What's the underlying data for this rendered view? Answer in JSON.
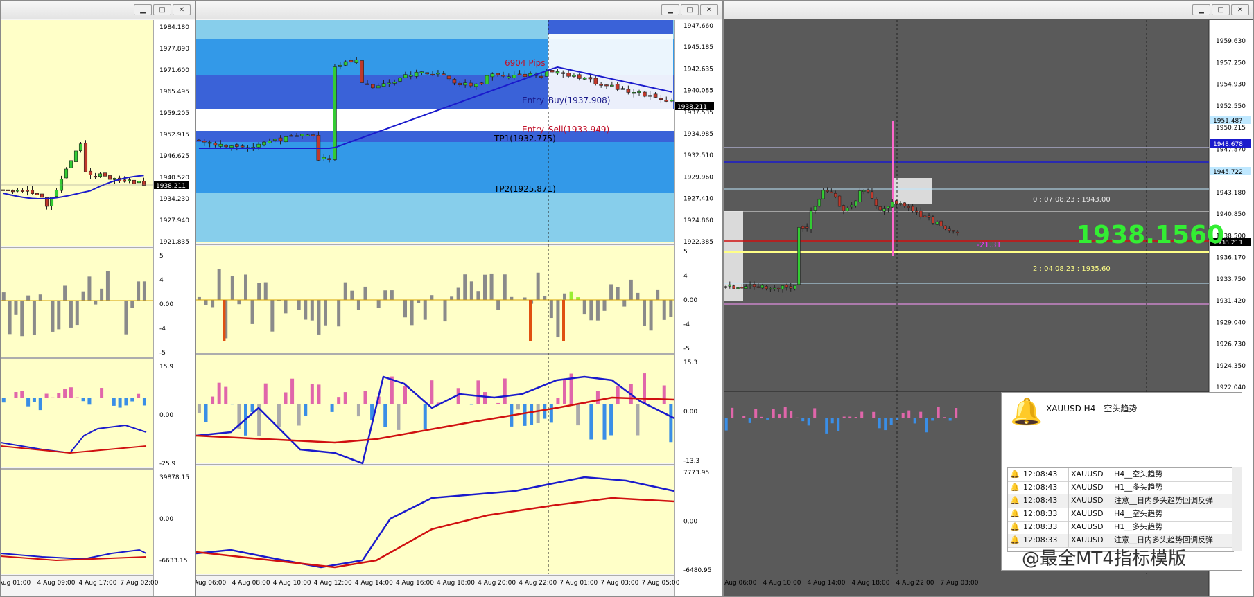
{
  "windows": [
    {
      "id": "w1",
      "controls": [
        "▁",
        "□",
        "✕"
      ]
    },
    {
      "id": "w2",
      "controls": [
        "▁",
        "□",
        "✕"
      ]
    },
    {
      "id": "w3",
      "controls": [
        "▁",
        "□",
        "✕"
      ]
    }
  ],
  "chart1": {
    "price_scale": [
      "1984.180",
      "1977.890",
      "1971.600",
      "1965.495",
      "1959.205",
      "1952.915",
      "1946.625",
      "1940.520",
      "1934.230",
      "1927.940",
      "1921.835"
    ],
    "current_price": "1938.211",
    "osc1_scale": [
      "5",
      "4",
      "0.00",
      "-4",
      "-5"
    ],
    "osc2_scale": [
      "15.9",
      "0.00",
      "-25.9"
    ],
    "osc3_scale": [
      "39878.15",
      "0.00",
      "-6633.15"
    ],
    "time_labels": [
      "Aug 01:00",
      "4 Aug 09:00",
      "4 Aug 17:00",
      "7 Aug 02:00"
    ]
  },
  "chart2": {
    "price_scale": [
      "1947.660",
      "1945.185",
      "1942.635",
      "1940.085",
      "1937.535",
      "1934.985",
      "1932.510",
      "1929.960",
      "1927.410",
      "1924.860",
      "1922.385"
    ],
    "current_price": "1938.211",
    "labels": {
      "entry_buy": "Entry_Buy(1937.908)",
      "entry_sell": "Entry_Sell(1933.949)",
      "tp1": "TP1(1932.775)",
      "tp2": "TP2(1925.871)",
      "pips": "6904 Pips"
    },
    "osc1_scale": [
      "5",
      "4",
      "0.00",
      "-4",
      "-5"
    ],
    "osc2_scale": [
      "15.3",
      "0.00",
      "-13.3"
    ],
    "osc3_scale": [
      "7773.95",
      "0.00",
      "-6480.95"
    ],
    "time_labels": [
      "Aug 06:00",
      "4 Aug 08:00",
      "4 Aug 10:00",
      "4 Aug 12:00",
      "4 Aug 14:00",
      "4 Aug 16:00",
      "4 Aug 18:00",
      "4 Aug 20:00",
      "4 Aug 22:00",
      "7 Aug 01:00",
      "7 Aug 03:00",
      "7 Aug 05:00"
    ]
  },
  "chart3": {
    "price_scale": [
      "1959.630",
      "1957.250",
      "1954.930",
      "1952.550",
      "1950.215",
      "1947.870",
      "1945.530",
      "1943.180",
      "1940.850",
      "1938.500",
      "1936.170",
      "1933.750",
      "1931.420",
      "1929.040",
      "1926.730",
      "1924.350",
      "1922.040"
    ],
    "highlight_prices": [
      "1951.48?",
      "1948.678",
      "1945.722",
      "1938.211"
    ],
    "big_price": "1938.1560",
    "annotations": {
      "high": "0 : 07.08.23 : 1943.00",
      "low": "2 : 04.08.23 : 1935.60",
      "pips": "-21.31"
    },
    "time_labels": [
      "4 Aug 06:00",
      "4 Aug 10:00",
      "4 Aug 14:00",
      "4 Aug 18:00",
      "4 Aug 22:00",
      "7 Aug 03:00"
    ]
  },
  "alert": {
    "header_message": "XAUUSD H4__空头趋势",
    "rows": [
      {
        "time": "12:08:43",
        "symbol": "XAUUSD",
        "message": "H4__空头趋势"
      },
      {
        "time": "12:08:43",
        "symbol": "XAUUSD",
        "message": "H1__多头趋势"
      },
      {
        "time": "12:08:43",
        "symbol": "XAUUSD",
        "message": "注意__日内多头趋势回调反弹"
      },
      {
        "time": "12:08:33",
        "symbol": "XAUUSD",
        "message": "H4__空头趋势"
      },
      {
        "time": "12:08:33",
        "symbol": "XAUUSD",
        "message": "H1__多头趋势"
      },
      {
        "time": "12:08:33",
        "symbol": "XAUUSD",
        "message": "注意__日内多头趋势回调反弹"
      }
    ]
  },
  "watermark": "@最全MT4指标模版",
  "colors": {
    "chart_bg": "#ffffc8",
    "dark_bg": "#5a5a5a",
    "bull": "#33cc33",
    "bear": "#c0392b",
    "ma": "#1a1acc",
    "red_line": "#d01010",
    "zone_light": "#87ceeb",
    "zone_mid": "#3399e8",
    "zone_dark": "#3a62d8",
    "big_price": "#33ee33"
  }
}
